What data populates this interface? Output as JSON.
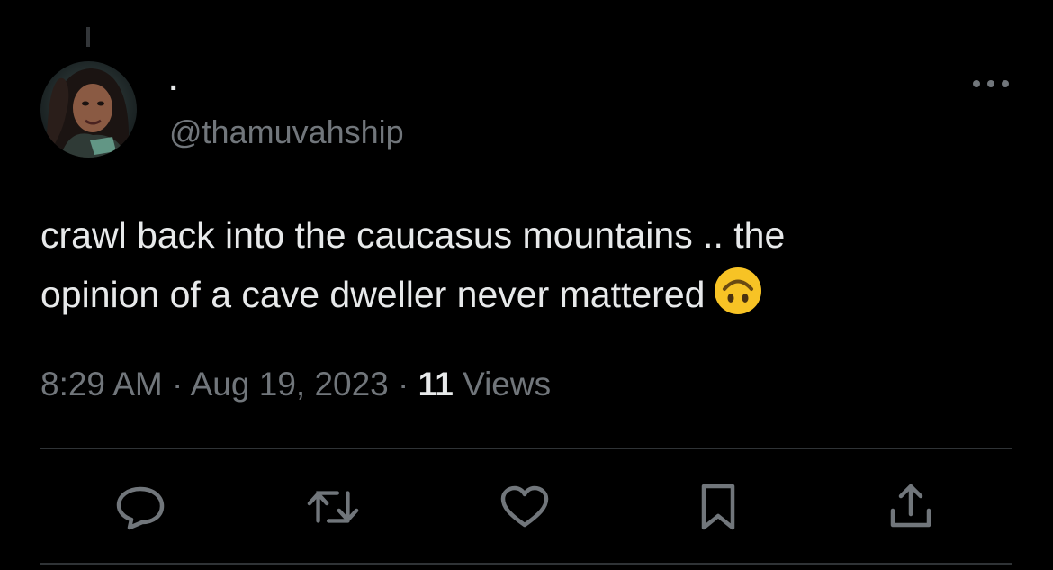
{
  "tweet": {
    "display_name": "·",
    "handle": "@thamuvahship",
    "text_line1": "crawl back into the caucasus mountains .. the",
    "text_line2": "opinion of a cave dweller never mattered",
    "emoji": "upside-down-face",
    "time": "8:29 AM",
    "separator": "·",
    "date": "Aug 19, 2023",
    "views_count": "11",
    "views_label": "Views"
  },
  "icons": {
    "more": "more-horizontal-icon",
    "reply": "reply-icon",
    "retweet": "retweet-icon",
    "like": "heart-icon",
    "bookmark": "bookmark-icon",
    "share": "share-icon"
  },
  "colors": {
    "background": "#000000",
    "text_primary": "#e7e9ea",
    "text_secondary": "#71767b",
    "divider": "#2f3336",
    "emoji_yellow": "#f7c325"
  }
}
